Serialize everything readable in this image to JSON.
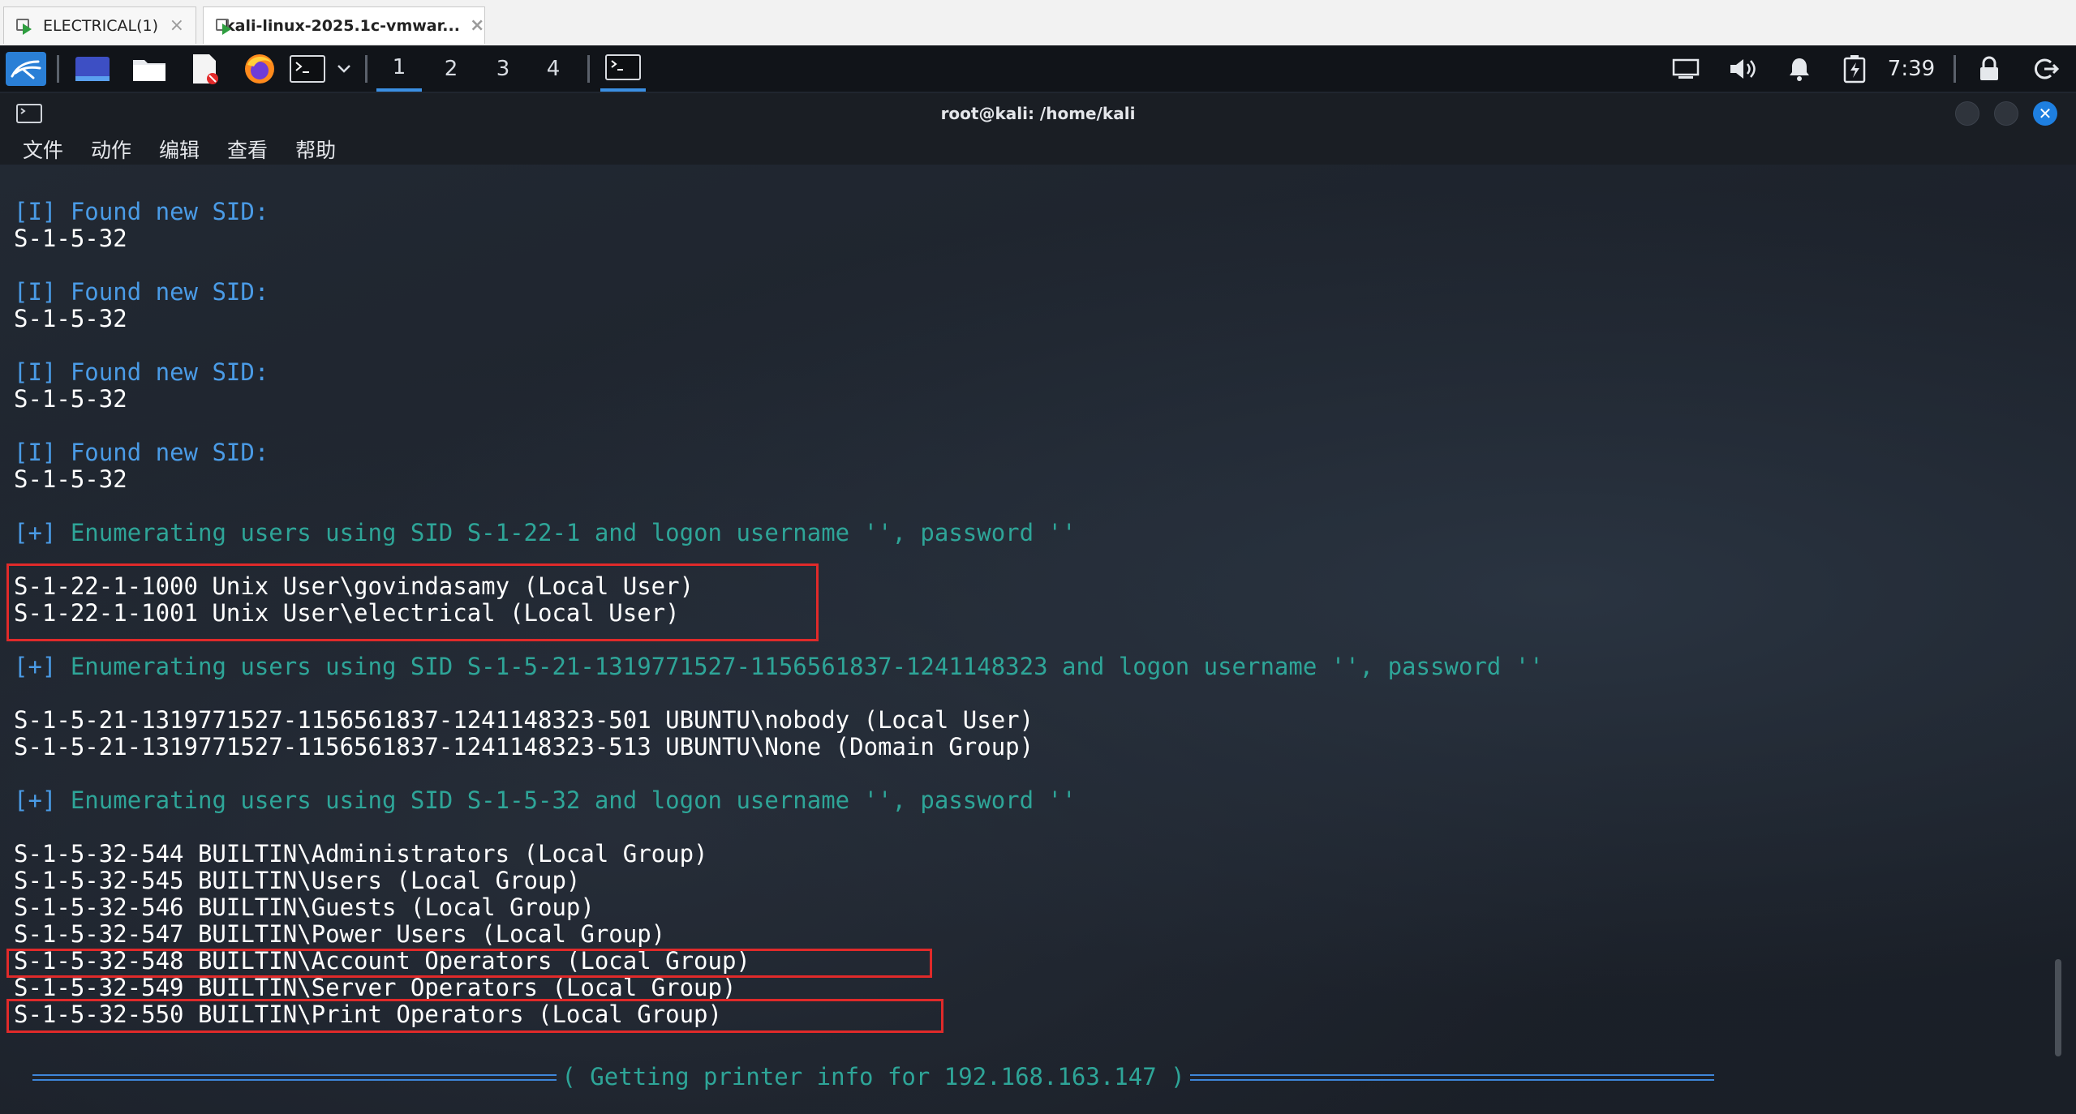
{
  "vm_tabs": [
    {
      "label": "ELECTRICAL(1)",
      "close": "×"
    },
    {
      "label": "kali-linux-2025.1c-vmwar...",
      "close": "×"
    }
  ],
  "panel": {
    "workspaces": [
      "1",
      "2",
      "3",
      "4"
    ],
    "clock": "7:39",
    "icons": [
      "kali-menu-icon",
      "show-desktop-icon",
      "file-manager-icon",
      "text-editor-icon",
      "firefox-icon",
      "terminal-icon",
      "dropdown-arrow-icon",
      "active-terminal-window-icon",
      "display-icon",
      "volume-icon",
      "notification-bell-icon",
      "power-manager-icon",
      "lock-icon",
      "logout-icon"
    ]
  },
  "window": {
    "title": "root@kali: /home/kali",
    "menu": [
      "文件",
      "动作",
      "编辑",
      "查看",
      "帮助"
    ]
  },
  "terminal": {
    "sid_blocks": [
      {
        "tag": "[I]",
        "text": " Found new SID:",
        "sid": "S-1-5-32"
      },
      {
        "tag": "[I]",
        "text": " Found new SID:",
        "sid": "S-1-5-32"
      },
      {
        "tag": "[I]",
        "text": " Found new SID:",
        "sid": "S-1-5-32"
      },
      {
        "tag": "[I]",
        "text": " Found new SID:",
        "sid": "S-1-5-32"
      }
    ],
    "enum_1": {
      "tag": "[+]",
      "text": " Enumerating users using SID S-1-22-1 and logon username '', password ''"
    },
    "unix_users": [
      "S-1-22-1-1000 Unix User\\govindasamy (Local User)",
      "S-1-22-1-1001 Unix User\\electrical (Local User)"
    ],
    "enum_2": {
      "tag": "[+]",
      "text": " Enumerating users using SID S-1-5-21-1319771527-1156561837-1241148323 and logon username '', password ''"
    },
    "domain_users": [
      "S-1-5-21-1319771527-1156561837-1241148323-501 UBUNTU\\nobody (Local User)",
      "S-1-5-21-1319771527-1156561837-1241148323-513 UBUNTU\\None (Domain Group)"
    ],
    "enum_3": {
      "tag": "[+]",
      "text": " Enumerating users using SID S-1-5-32 and logon username '', password ''"
    },
    "builtin_groups": [
      "S-1-5-32-544 BUILTIN\\Administrators (Local Group)",
      "S-1-5-32-545 BUILTIN\\Users (Local Group)",
      "S-1-5-32-546 BUILTIN\\Guests (Local Group)",
      "S-1-5-32-547 BUILTIN\\Power Users (Local Group)",
      "S-1-5-32-548 BUILTIN\\Account Operators (Local Group)",
      "S-1-5-32-549 BUILTIN\\Server Operators (Local Group)",
      "S-1-5-32-550 BUILTIN\\Print Operators (Local Group)"
    ],
    "banner": "( Getting printer info for 192.168.163.147 )"
  },
  "colors": {
    "tag_blue": "#4a9be6",
    "info_teal": "#2ea598",
    "highlight_red": "#e02a2a",
    "panel_bg": "#111419",
    "workspace_active": "#3b8fe3"
  }
}
